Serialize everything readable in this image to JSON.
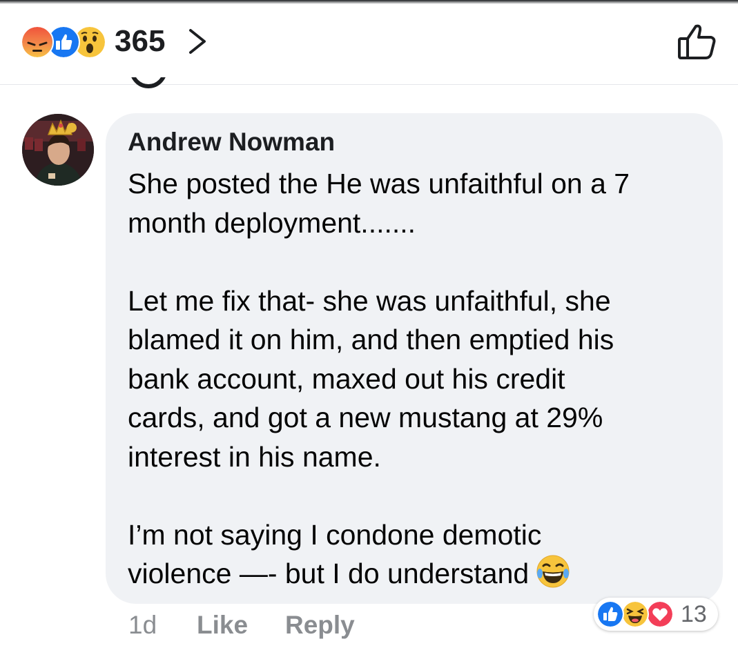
{
  "header": {
    "reaction_icons": [
      "angry-reaction-icon",
      "like-reaction-icon",
      "wow-reaction-icon"
    ],
    "reaction_count": "365"
  },
  "comment": {
    "author": "Andrew Nowman",
    "paragraphs": [
      "She posted the He was unfaithful on a 7\nmonth deployment.......",
      "Let me fix that- she was unfaithful, she\nblamed it on him, and then emptied his\nbank account, maxed out his credit\ncards, and got a new mustang at 29%\ninterest in his name.",
      "I’m not saying I condone demotic\nviolence —- but I do understand"
    ],
    "trailing_emoji": "laughing-tears-emoji-icon",
    "time": "1d",
    "like_label": "Like",
    "reply_label": "Reply",
    "reaction_icons": [
      "like-reaction-icon",
      "haha-reaction-icon",
      "love-reaction-icon"
    ],
    "reaction_count": "13"
  },
  "colors": {
    "bubble": "#f0f2f5",
    "like_blue": "#1877f2",
    "love_red": "#f33e58",
    "reaction_yellow": "#f7b125",
    "meta_gray": "#8a8d91"
  }
}
